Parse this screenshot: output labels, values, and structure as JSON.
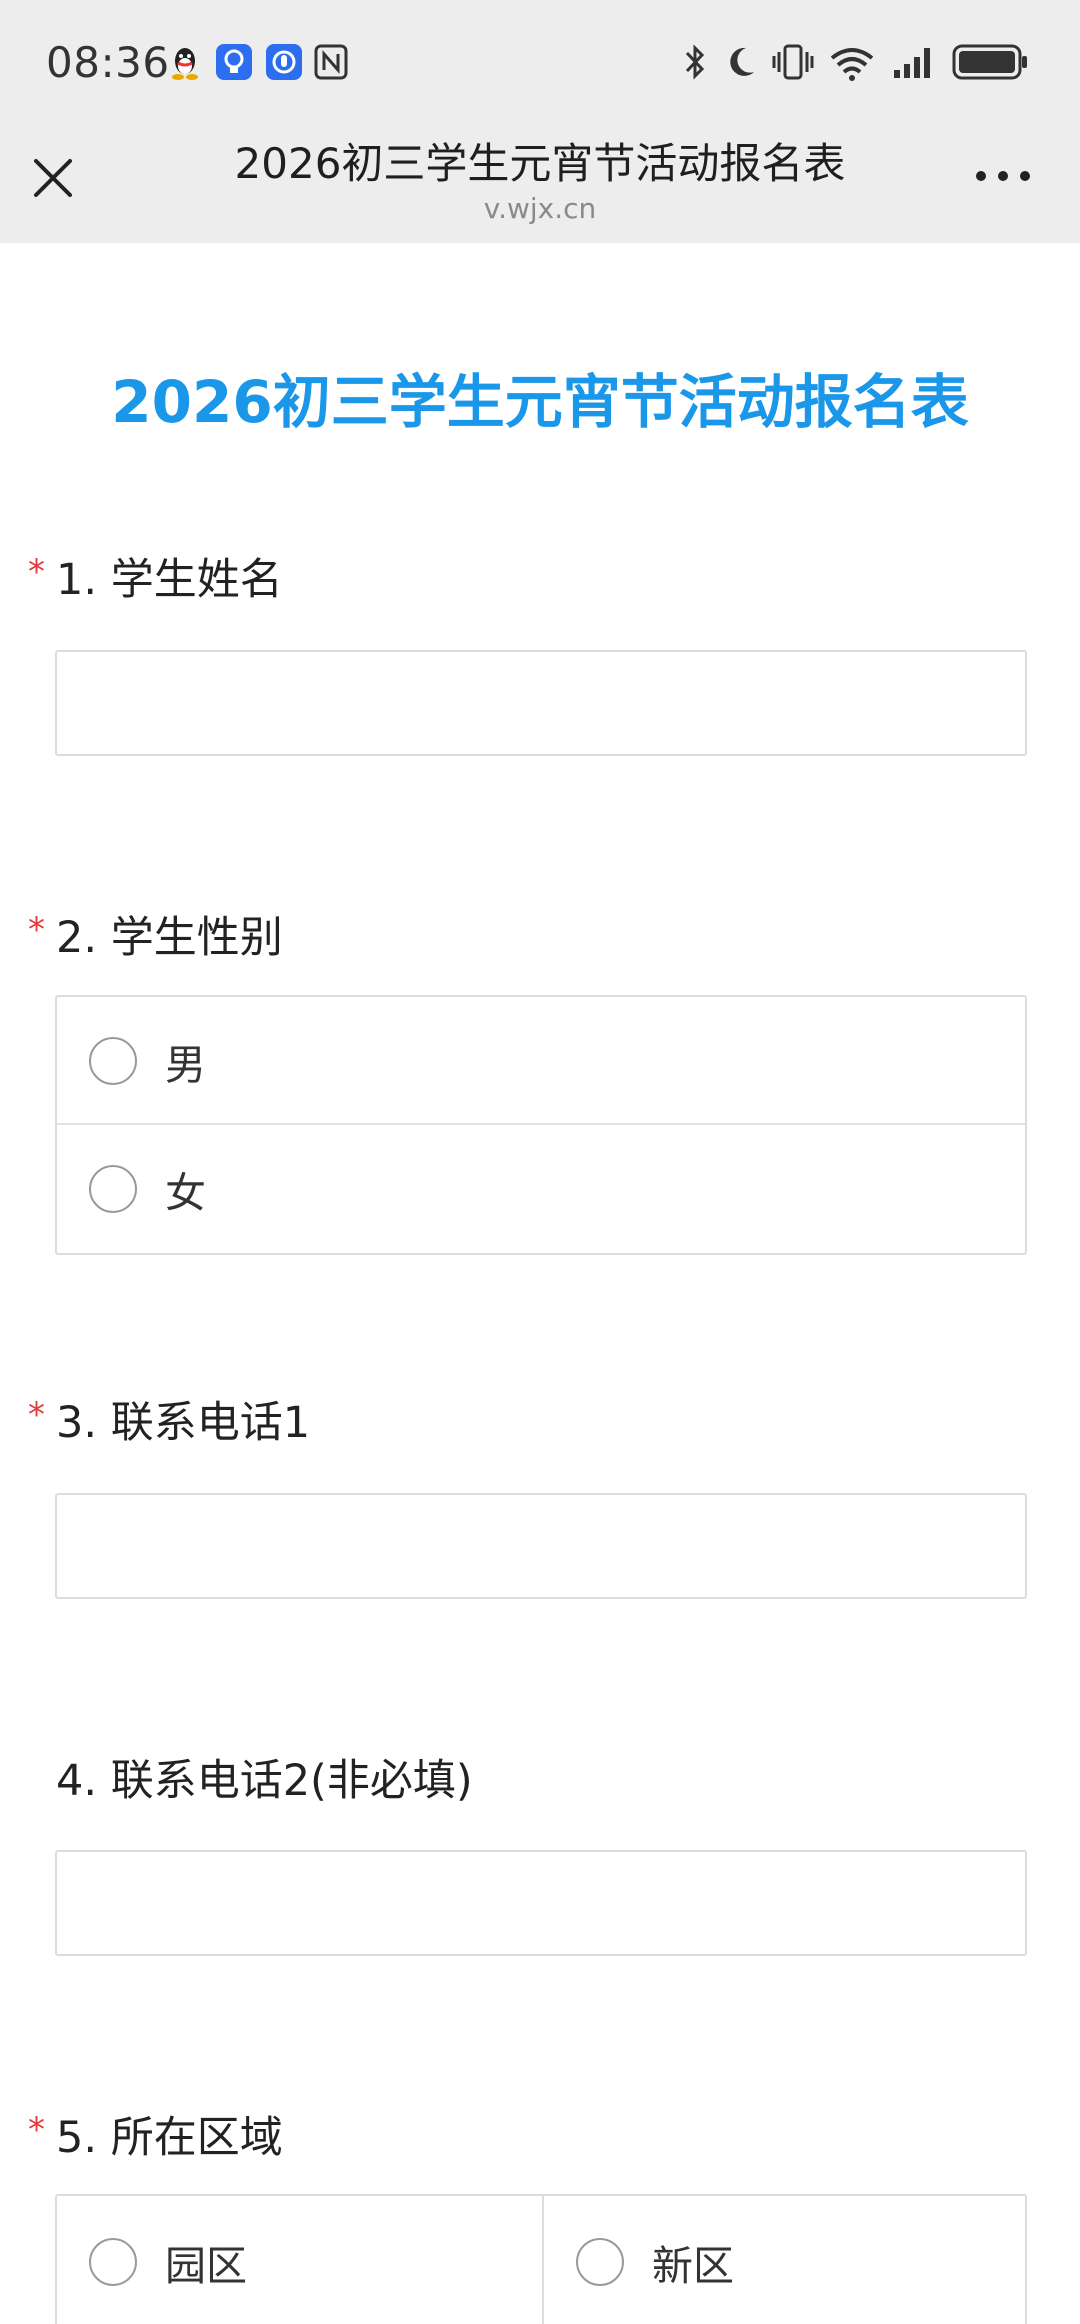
{
  "status_bar": {
    "time": "08:36",
    "left_icons": [
      "qq-penguin-icon",
      "lightbulb-app-icon",
      "hand-app-icon",
      "nfc-icon"
    ],
    "right_icons": [
      "bluetooth-icon",
      "moon-icon",
      "vibrate-icon",
      "wifi-icon",
      "cellular-signal-icon",
      "battery-icon"
    ]
  },
  "header": {
    "title": "2026初三学生元宵节活动报名表",
    "url": "v.wjx.cn"
  },
  "form": {
    "title": "2026初三学生元宵节活动报名表",
    "questions": [
      {
        "label": "1. 学生姓名",
        "required": "*",
        "type": "text",
        "value": ""
      },
      {
        "label": "2. 学生性别",
        "required": "*",
        "type": "radio",
        "options": [
          "男",
          "女"
        ]
      },
      {
        "label": "3. 联系电话1",
        "required": "*",
        "type": "text",
        "value": ""
      },
      {
        "label": "4. 联系电话2(非必填)",
        "type": "text",
        "value": ""
      },
      {
        "label": "5.  所在区域",
        "required": "*",
        "type": "radio-grid",
        "options": [
          "园区",
          "新区"
        ]
      }
    ]
  },
  "colors": {
    "title_blue": "#1a97e8",
    "required_red": "#e23b3b",
    "header_bg": "#ededed"
  }
}
